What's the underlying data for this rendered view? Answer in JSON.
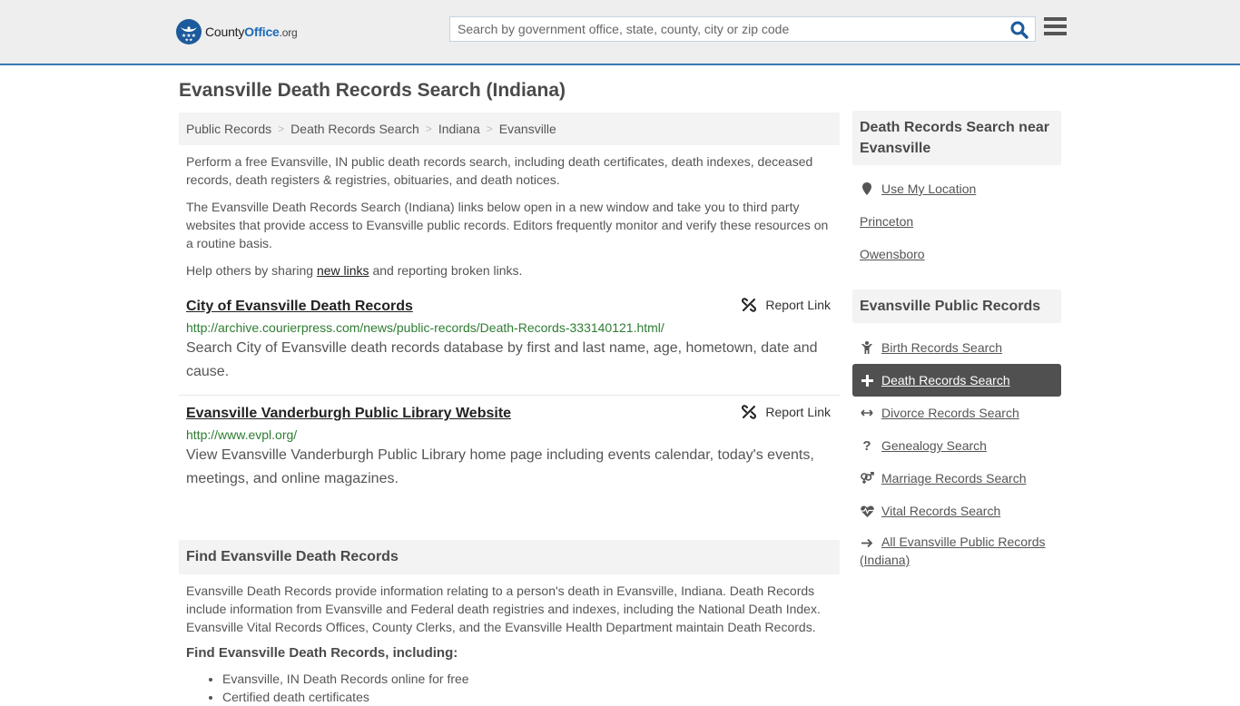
{
  "header": {
    "logo": {
      "county": "County",
      "office": "Office",
      "org": ".org"
    },
    "search_placeholder": "Search by government office, state, county, city or zip code",
    "search_icon": "search-icon",
    "menu_icon": "hamburger-menu-icon",
    "accent_color": "#3a7ab4"
  },
  "page_title": "Evansville Death Records Search (Indiana)",
  "breadcrumb": [
    {
      "label": "Public Records"
    },
    {
      "label": "Death Records Search"
    },
    {
      "label": "Indiana"
    },
    {
      "label": "Evansville"
    }
  ],
  "intro": {
    "p1": "Perform a free Evansville, IN public death records search, including death certificates, death indexes, deceased records, death registers & registries, obituaries, and death notices.",
    "p2": "The Evansville Death Records Search (Indiana) links below open in a new window and take you to third party websites that provide access to Evansville public records. Editors frequently monitor and verify these resources on a routine basis.",
    "p3_before": "Help others by sharing ",
    "p3_link": "new links",
    "p3_after": " and reporting broken links."
  },
  "results": [
    {
      "title": "City of Evansville Death Records",
      "url": "http://archive.courierpress.com/news/public-records/Death-Records-333140121.html/",
      "description": "Search City of Evansville death records database by first and last name, age, hometown, date and cause.",
      "report_label": "Report Link"
    },
    {
      "title": "Evansville Vanderburgh Public Library Website",
      "url": "http://www.evpl.org/",
      "description": "View Evansville Vanderburgh Public Library home page including events calendar, today's events, meetings, and online magazines.",
      "report_label": "Report Link"
    }
  ],
  "find_section": {
    "heading": "Find Evansville Death Records",
    "paragraph": "Evansville Death Records provide information relating to a person's death in Evansville, Indiana. Death Records include information from Evansville and Federal death registries and indexes, including the National Death Index. Evansville Vital Records Offices, County Clerks, and the Evansville Health Department maintain Death Records.",
    "subheading": "Find Evansville Death Records, including:",
    "bullets": [
      "Evansville, IN Death Records online for free",
      "Certified death certificates"
    ]
  },
  "sidebar": {
    "nearby": {
      "heading": "Death Records Search near Evansville",
      "items": [
        {
          "label": "Use My Location",
          "icon": "map-marker-icon"
        },
        {
          "label": "Princeton"
        },
        {
          "label": "Owensboro"
        }
      ]
    },
    "public_records": {
      "heading": "Evansville Public Records",
      "items": [
        {
          "label": "Birth Records Search",
          "icon": "child-icon"
        },
        {
          "label": "Death Records Search",
          "icon": "plus-icon",
          "active": true
        },
        {
          "label": "Divorce Records Search",
          "icon": "arrows-horizontal-icon"
        },
        {
          "label": "Genealogy Search",
          "icon": "question-icon"
        },
        {
          "label": "Marriage Records Search",
          "icon": "venus-mars-icon"
        },
        {
          "label": "Vital Records Search",
          "icon": "heartbeat-icon"
        },
        {
          "label": "All Evansville Public Records (Indiana)",
          "icon": "arrow-right-icon"
        }
      ]
    }
  }
}
